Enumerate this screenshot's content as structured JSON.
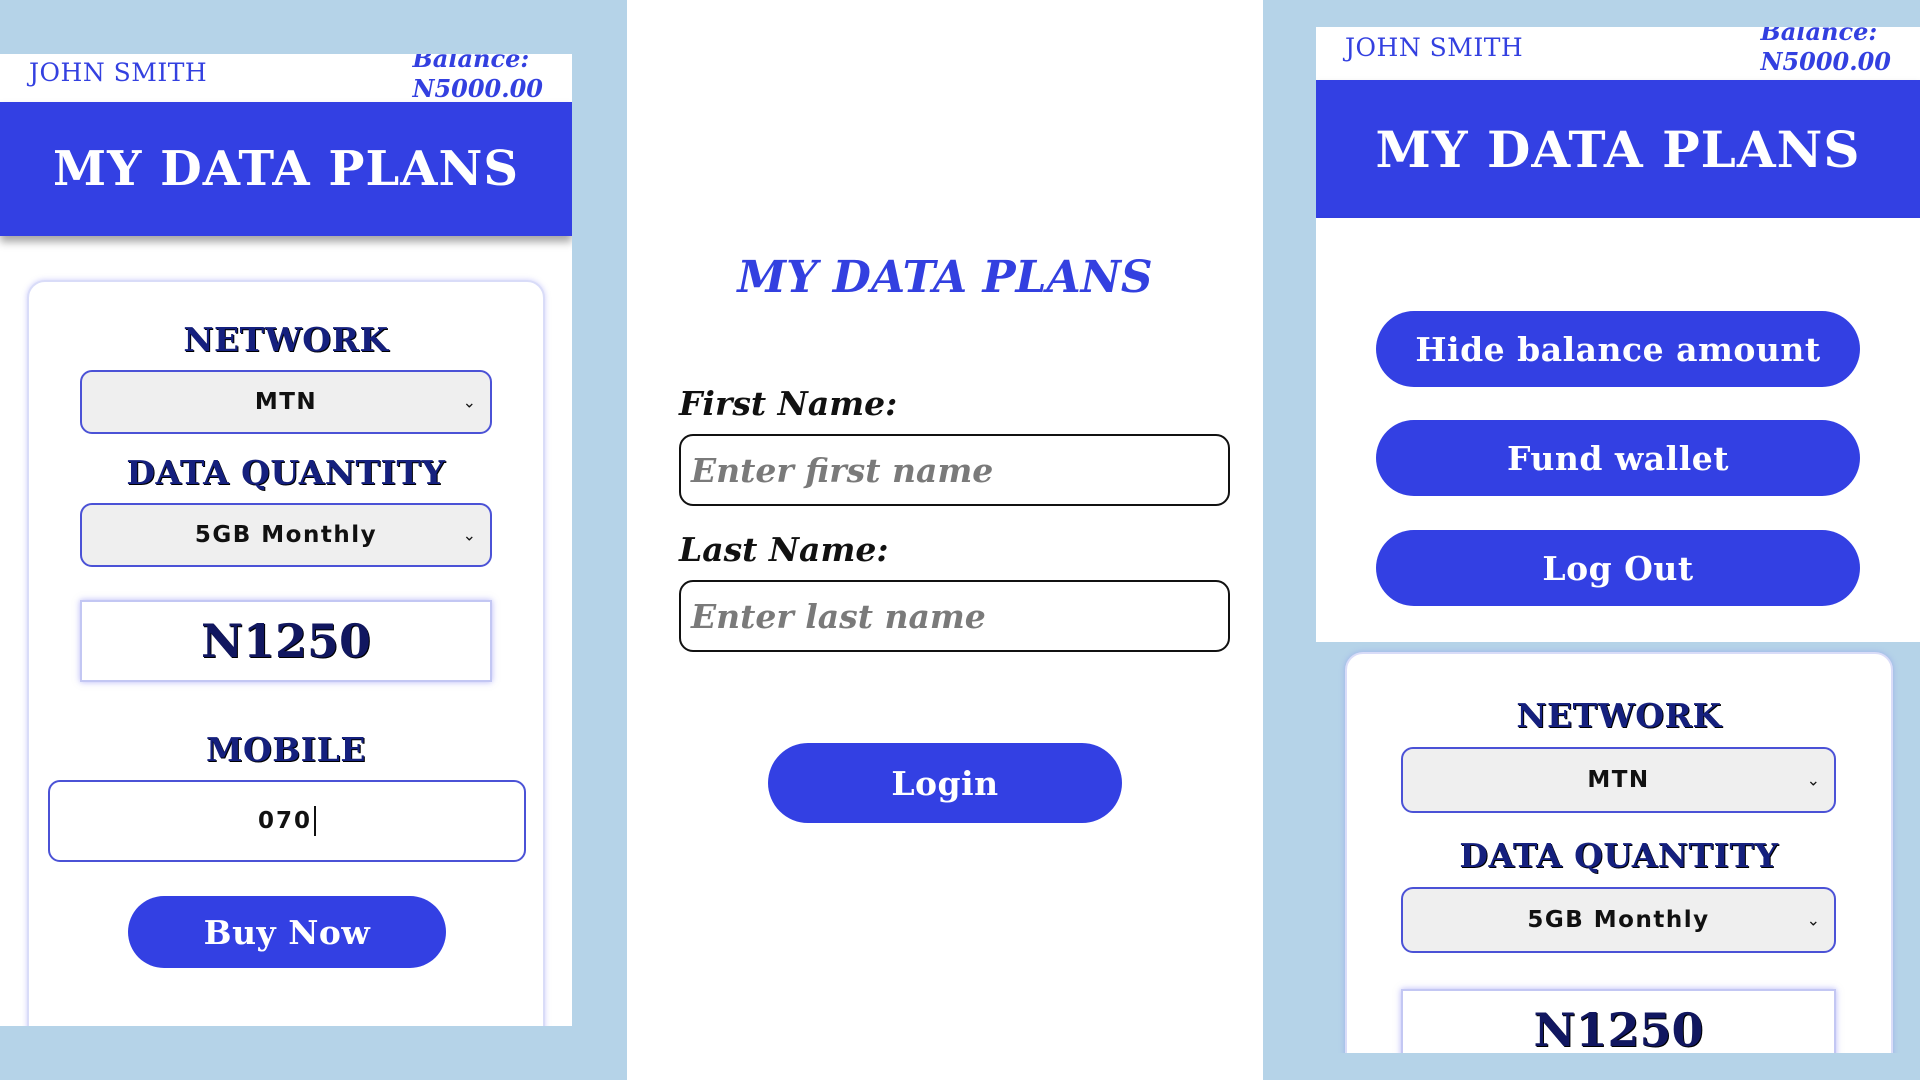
{
  "app": {
    "title": "MY DATA PLANS"
  },
  "user": {
    "name": "JOHN SMITH",
    "balance_label": "Balance:",
    "balance_value": "N5000.00"
  },
  "purchase_form": {
    "network_label": "NETWORK",
    "network_selected": "MTN",
    "data_quantity_label": "DATA QUANTITY",
    "data_quantity_selected": "5GB Monthly",
    "price": "N1250",
    "mobile_label": "MOBILE",
    "mobile_value": "070",
    "buy_button": "Buy Now"
  },
  "login": {
    "title": "MY DATA PLANS",
    "first_name_label": "First Name:",
    "first_name_placeholder": "Enter first name",
    "last_name_label": "Last Name:",
    "last_name_placeholder": "Enter last name",
    "login_button": "Login"
  },
  "menu": {
    "hide_balance": "Hide balance amount",
    "fund_wallet": "Fund wallet",
    "log_out": "Log Out"
  },
  "colors": {
    "primary": "#3340e3",
    "background": "#b5d3e8",
    "label_dark": "#15207e"
  },
  "icons": {
    "select_chevron": "chevron-down-icon"
  }
}
